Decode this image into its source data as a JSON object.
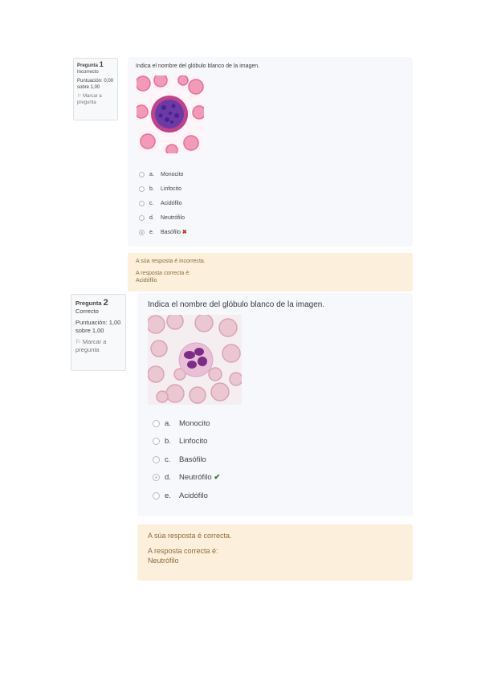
{
  "q1": {
    "label": "Pregunta",
    "number": "1",
    "state": "Incorrecto",
    "grade": "Puntuación: 0,00 sobre 1,00",
    "flag": "Marcar a pregunta",
    "question": "Indica el nombre del glóbulo blanco de la imagen.",
    "answers": [
      {
        "letter": "a.",
        "text": "Monocito",
        "selected": false
      },
      {
        "letter": "b.",
        "text": "Linfocito",
        "selected": false
      },
      {
        "letter": "c.",
        "text": "Acidófilo",
        "selected": false
      },
      {
        "letter": "d.",
        "text": "Neutrófilo",
        "selected": false
      },
      {
        "letter": "e.",
        "text": "Basófilo",
        "selected": true,
        "mark": "✖"
      }
    ],
    "feedback": {
      "result": "A súa resposta é incorrecta.",
      "right_label": "A resposta correcta é:",
      "right_answer": "Acidófilo"
    }
  },
  "q2": {
    "label": "Pregunta",
    "number": "2",
    "state": "Correcto",
    "grade": "Puntuación: 1,00 sobre 1,00",
    "flag": "Marcar a pregunta",
    "question": "Indica el nombre del glóbulo blanco de la imagen.",
    "answers": [
      {
        "letter": "a.",
        "text": "Monocito",
        "selected": false
      },
      {
        "letter": "b.",
        "text": "Linfocito",
        "selected": false
      },
      {
        "letter": "c.",
        "text": "Basófilo",
        "selected": false
      },
      {
        "letter": "d.",
        "text": "Neutrófilo",
        "selected": true,
        "mark": "✔"
      },
      {
        "letter": "e.",
        "text": "Acidófilo",
        "selected": false
      }
    ],
    "feedback": {
      "result": "A súa resposta é correcta.",
      "right_label": "A resposta correcta é:",
      "right_answer": "Neutrófilo"
    }
  },
  "colors": {
    "panel_bg": "#f6f8fb",
    "feedback_bg": "#fcefdc",
    "feedback_text": "#8a6d3b",
    "incorrect_mark": "#ca3120",
    "correct_mark": "#357a32"
  }
}
